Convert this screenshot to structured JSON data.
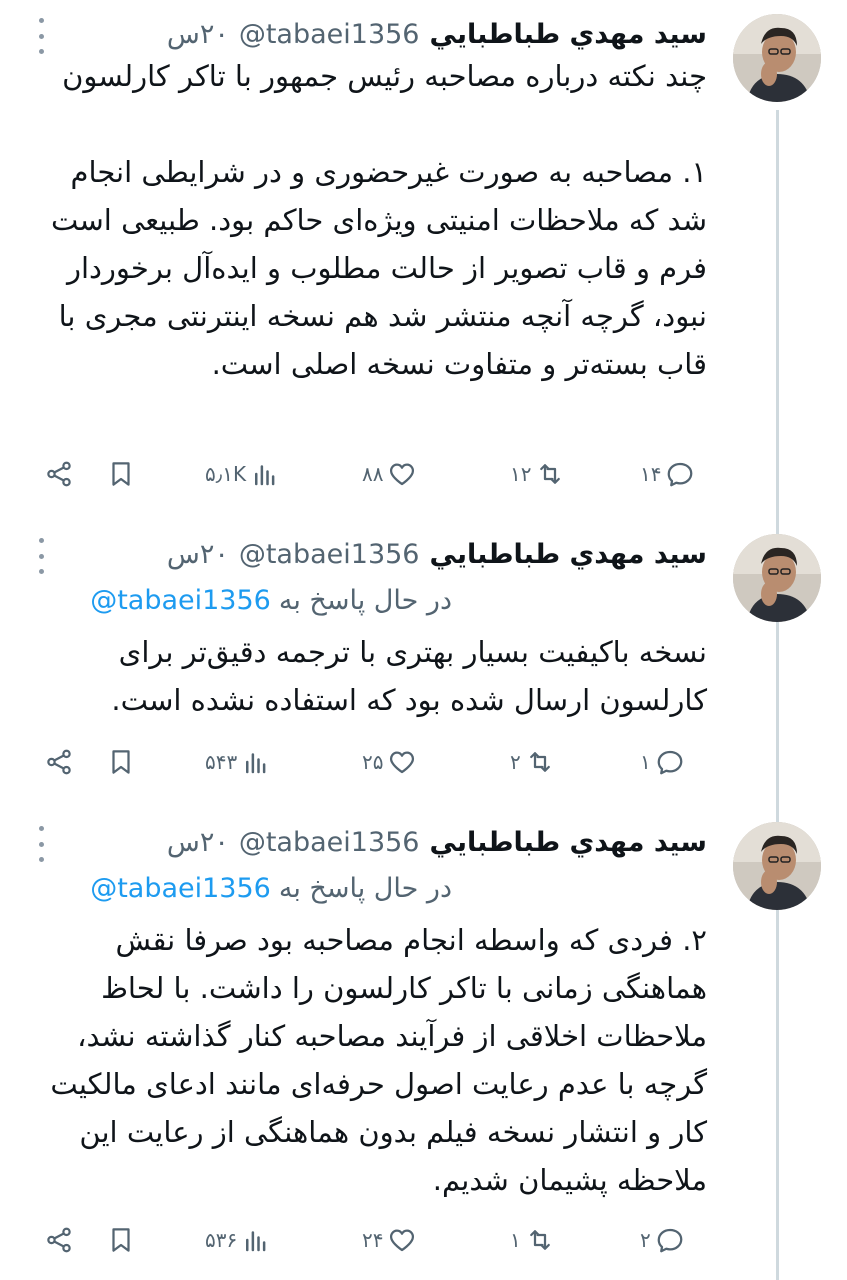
{
  "tweets": [
    {
      "author_name": "سيد مهدي طباطبايي",
      "handle": "@tabaei1356",
      "time": "۲۰س",
      "reply_prefix": "",
      "reply_mention": "",
      "text": "چند نکته درباره مصاحبه رئیس جمهور با تاکر کارلسون\n\n۱. مصاحبه به صورت غیرحضوری و در شرایطی انجام شد که ملاحظات امنیتی ویژه‌ای حاکم بود. طبیعی است فرم و قاب تصویر از حالت مطلوب و ایده‌آل برخوردار نبود، گرچه آنچه منتشر شد هم نسخه اینترنتی مجری با قاب بسته‌تر و متفاوت نسخه اصلی است.",
      "replies": "۱۴",
      "retweets": "۱۲",
      "likes": "۸۸",
      "views": "۵٫۱K"
    },
    {
      "author_name": "سيد مهدي طباطبايي",
      "handle": "@tabaei1356",
      "time": "۲۰س",
      "reply_prefix": "در حال پاسخ به",
      "reply_mention": "@tabaei1356",
      "text": "نسخه باکیفیت بسیار بهتری با ترجمه دقیق‌تر برای کارلسون ارسال شده بود که استفاده نشده است.",
      "replies": "۱",
      "retweets": "۲",
      "likes": "۲۵",
      "views": "۵۴۳"
    },
    {
      "author_name": "سيد مهدي طباطبايي",
      "handle": "@tabaei1356",
      "time": "۲۰س",
      "reply_prefix": "در حال پاسخ به",
      "reply_mention": "@tabaei1356",
      "text": "۲. فردی که واسطه انجام مصاحبه بود صرفا نقش هماهنگی زمانی با تاکر کارلسون را داشت. با لحاظ ملاحظات اخلاقی از فرآیند مصاحبه کنار گذاشته نشد، گرچه با عدم رعایت اصول حرفه‌ای مانند ادعای مالکیت کار و انتشار نسخه فیلم بدون هماهنگی از رعایت این ملاحظه پشیمان شدیم.",
      "replies": "۲",
      "retweets": "۱",
      "likes": "۲۴",
      "views": "۵۳۶"
    }
  ],
  "icons": {
    "reply": "reply-icon",
    "retweet": "retweet-icon",
    "like": "heart-icon",
    "views": "views-icon",
    "bookmark": "bookmark-icon",
    "share": "share-icon",
    "more": "more-icon"
  },
  "colors": {
    "text": "#0f1419",
    "secondary": "#536471",
    "link": "#1d9bf0",
    "thread_line": "#cfd9de"
  }
}
